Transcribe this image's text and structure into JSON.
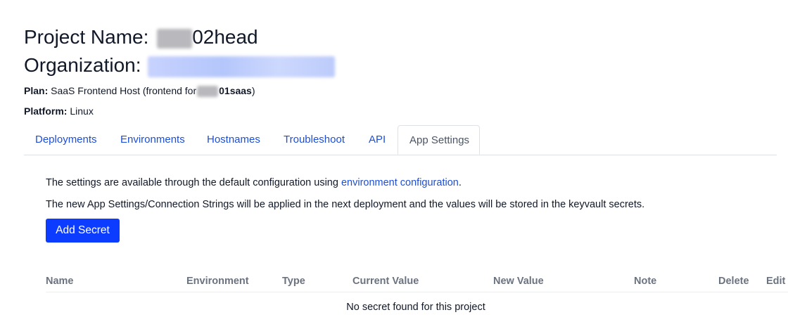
{
  "project": {
    "label": "Project Name:",
    "name_suffix": "02head"
  },
  "organization": {
    "label": "Organization:"
  },
  "plan": {
    "label": "Plan:",
    "value_prefix": "SaaS Frontend Host (frontend for",
    "value_bold": "01saas",
    "value_suffix": ")"
  },
  "platform": {
    "label": "Platform:",
    "value": "Linux"
  },
  "tabs": [
    {
      "label": "Deployments",
      "active": false
    },
    {
      "label": "Environments",
      "active": false
    },
    {
      "label": "Hostnames",
      "active": false
    },
    {
      "label": "Troubleshoot",
      "active": false
    },
    {
      "label": "API",
      "active": false
    },
    {
      "label": "App Settings",
      "active": true
    }
  ],
  "settings": {
    "line1_text": "The settings are available through the default configuration using ",
    "line1_link": "environment configuration",
    "line1_end": ".",
    "line2_text": "The new App Settings/Connection Strings will be applied in the next deployment and the values will be stored in the keyvault secrets.",
    "add_button": "Add Secret"
  },
  "table": {
    "columns": [
      "Name",
      "Environment",
      "Type",
      "Current Value",
      "New Value",
      "Note",
      "Delete",
      "Edit"
    ],
    "empty_message": "No secret found for this project"
  },
  "colors": {
    "primary": "#0b3cff",
    "link": "#1d4ed8",
    "header_text": "#6b7280"
  }
}
